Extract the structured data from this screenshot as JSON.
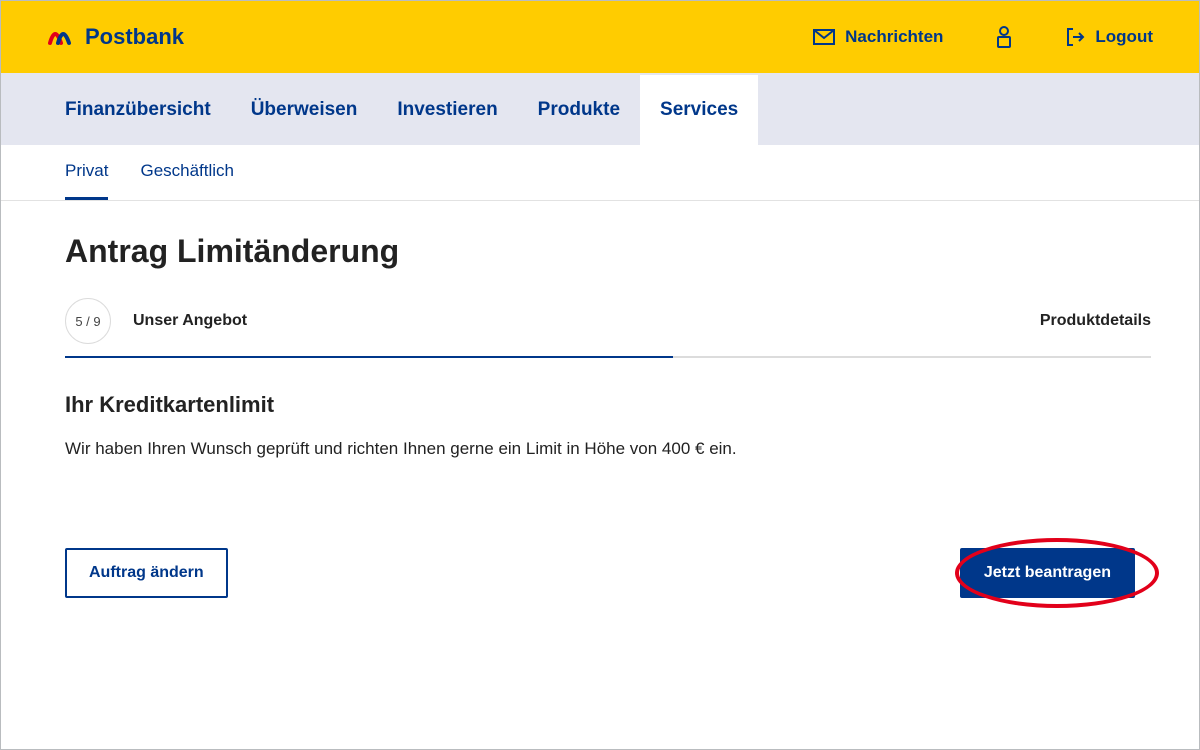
{
  "brand": {
    "name": "Postbank"
  },
  "topLinks": {
    "messages": "Nachrichten",
    "logout": "Logout"
  },
  "nav": {
    "items": [
      "Finanzübersicht",
      "Überweisen",
      "Investieren",
      "Produkte",
      "Services"
    ],
    "activeIndex": 4
  },
  "subnav": {
    "items": [
      "Privat",
      "Geschäftlich"
    ],
    "activeIndex": 0
  },
  "page": {
    "title": "Antrag Limitänderung",
    "step": "5 / 9",
    "stepName": "Unser Angebot",
    "detailsLink": "Produktdetails",
    "sectionTitle": "Ihr Kreditkartenlimit",
    "sectionBody": "Wir haben Ihren Wunsch geprüft und richten Ihnen gerne ein Limit in Höhe von 400 € ein.",
    "secondaryButton": "Auftrag ändern",
    "primaryButton": "Jetzt beantragen"
  }
}
